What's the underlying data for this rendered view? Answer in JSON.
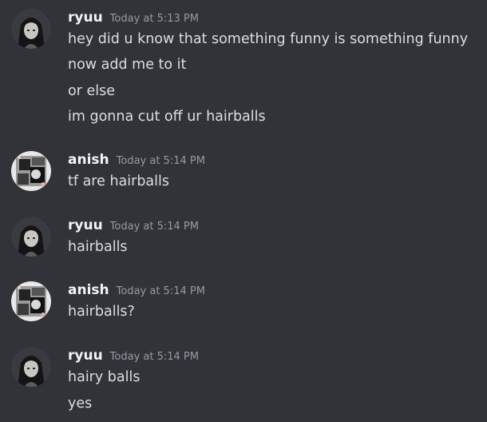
{
  "colors": {
    "background": "#313338",
    "username": "#f2f3f5",
    "timestamp": "#949ba4",
    "message_text": "#dbdee1"
  },
  "messages": [
    {
      "author": "ryuu",
      "avatar_icon": "anime-girl-avatar-icon",
      "timestamp": "Today at 5:13 PM",
      "lines": [
        "hey did u know that something funny is something funny",
        "now add me to it",
        "or else",
        "im gonna cut off ur hairballs"
      ]
    },
    {
      "author": "anish",
      "avatar_icon": "grayscale-collage-avatar-icon",
      "timestamp": "Today at 5:14 PM",
      "lines": [
        "tf are hairballs"
      ]
    },
    {
      "author": "ryuu",
      "avatar_icon": "anime-girl-avatar-icon",
      "timestamp": "Today at 5:14 PM",
      "lines": [
        "hairballs"
      ]
    },
    {
      "author": "anish",
      "avatar_icon": "grayscale-collage-avatar-icon",
      "timestamp": "Today at 5:14 PM",
      "lines": [
        "hairballs?"
      ]
    },
    {
      "author": "ryuu",
      "avatar_icon": "anime-girl-avatar-icon",
      "timestamp": "Today at 5:14 PM",
      "lines": [
        "hairy balls",
        "yes"
      ]
    }
  ]
}
